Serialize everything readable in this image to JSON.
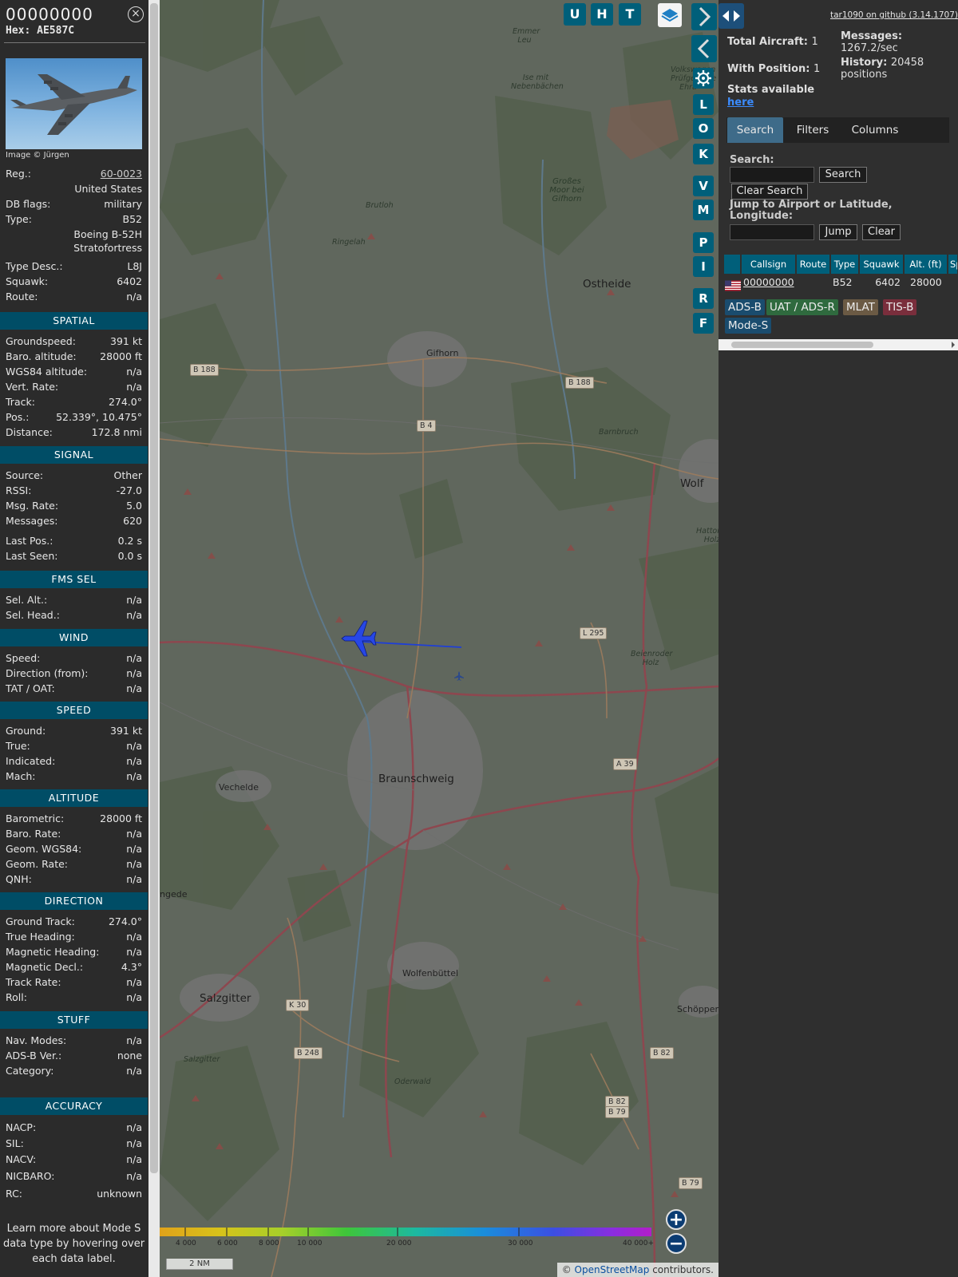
{
  "info": {
    "callsign": "00000000",
    "hex": "Hex: AE587C",
    "close_symbol": "×",
    "photo_credit": "Image © Jürgen",
    "general": [
      {
        "label": "Reg.:",
        "value": "60-0023",
        "link": true
      },
      {
        "label": "",
        "value": "United States"
      },
      {
        "label": "DB flags:",
        "value": "military"
      },
      {
        "label": "Type:",
        "value": "B52"
      },
      {
        "label": "",
        "value": "Boeing B-52H"
      },
      {
        "label": "",
        "value": "Stratofortress"
      },
      {
        "label": "Type Desc.:",
        "value": "L8J"
      },
      {
        "label": "Squawk:",
        "value": "6402"
      },
      {
        "label": "Route:",
        "value": "n/a"
      }
    ],
    "sections": {
      "spatial": "SPATIAL",
      "signal": "SIGNAL",
      "fms": "FMS SEL",
      "wind": "WIND",
      "speed": "SPEED",
      "altitude": "ALTITUDE",
      "direction": "DIRECTION",
      "stuff": "STUFF",
      "accuracy": "ACCURACY"
    },
    "spatial": [
      {
        "label": "Groundspeed:",
        "value": "391 kt"
      },
      {
        "label": "Baro. altitude:",
        "value": "28000 ft"
      },
      {
        "label": "WGS84 altitude:",
        "value": "n/a"
      },
      {
        "label": "Vert. Rate:",
        "value": "n/a"
      },
      {
        "label": "Track:",
        "value": "274.0°"
      },
      {
        "label": "Pos.:",
        "value": "52.339°, 10.475°"
      },
      {
        "label": "Distance:",
        "value": "172.8 nmi"
      }
    ],
    "signal": [
      {
        "label": "Source:",
        "value": "Other"
      },
      {
        "label": "RSSI:",
        "value": "-27.0"
      },
      {
        "label": "Msg. Rate:",
        "value": "5.0"
      },
      {
        "label": "Messages:",
        "value": "620"
      },
      {
        "label": "Last Pos.:",
        "value": "0.2 s"
      },
      {
        "label": "Last Seen:",
        "value": "0.0 s"
      }
    ],
    "fms": [
      {
        "label": "Sel. Alt.:",
        "value": "n/a"
      },
      {
        "label": "Sel. Head.:",
        "value": "n/a"
      }
    ],
    "wind": [
      {
        "label": "Speed:",
        "value": "n/a"
      },
      {
        "label": "Direction (from):",
        "value": "n/a"
      },
      {
        "label": "TAT / OAT:",
        "value": "n/a"
      }
    ],
    "speed": [
      {
        "label": "Ground:",
        "value": "391 kt"
      },
      {
        "label": "True:",
        "value": "n/a"
      },
      {
        "label": "Indicated:",
        "value": "n/a"
      },
      {
        "label": "Mach:",
        "value": "n/a"
      }
    ],
    "altitude": [
      {
        "label": "Barometric:",
        "value": "28000 ft"
      },
      {
        "label": "Baro. Rate:",
        "value": "n/a"
      },
      {
        "label": "Geom. WGS84:",
        "value": "n/a"
      },
      {
        "label": "Geom. Rate:",
        "value": "n/a"
      },
      {
        "label": "QNH:",
        "value": "n/a"
      }
    ],
    "direction": [
      {
        "label": "Ground Track:",
        "value": "274.0°"
      },
      {
        "label": "True Heading:",
        "value": "n/a"
      },
      {
        "label": "Magnetic Heading:",
        "value": "n/a"
      },
      {
        "label": "Magnetic Decl.:",
        "value": "4.3°"
      },
      {
        "label": "Track Rate:",
        "value": "n/a"
      },
      {
        "label": "Roll:",
        "value": "n/a"
      }
    ],
    "stuff": [
      {
        "label": "Nav. Modes:",
        "value": "n/a"
      },
      {
        "label": "ADS-B Ver.:",
        "value": "none"
      },
      {
        "label": "Category:",
        "value": "n/a"
      }
    ],
    "accuracy": [
      {
        "label": "NACP:",
        "value": "n/a"
      },
      {
        "label": "SIL:",
        "value": "n/a"
      },
      {
        "label": "NACV:",
        "value": "n/a"
      },
      {
        "label": "NICBARO:",
        "value": "n/a"
      },
      {
        "label": "RC:",
        "value": "unknown"
      }
    ],
    "learn_more": "Learn more about Mode S data type by hovering over each data label."
  },
  "map": {
    "buttons_top": [
      "U",
      "H",
      "T"
    ],
    "buttons_side": [
      "L",
      "O",
      "K",
      "V",
      "M",
      "P",
      "I",
      "R",
      "F"
    ],
    "places": [
      {
        "text": "Emmer Leu",
        "cls": "small"
      },
      {
        "text": "Ise mit Nebenbächen",
        "cls": "small"
      },
      {
        "text": "Volkswagen Prüfgelände Ehra",
        "cls": "small"
      },
      {
        "text": "Großes Moor bei Gifhorn",
        "cls": "med"
      },
      {
        "text": "Brutloh",
        "cls": "small"
      },
      {
        "text": "Ringelah",
        "cls": "small"
      },
      {
        "text": "Ostheide",
        "cls": "big"
      },
      {
        "text": "Gifhorn",
        "cls": "city"
      },
      {
        "text": "Barnbruch",
        "cls": "small"
      },
      {
        "text": "Wolf",
        "cls": "big"
      },
      {
        "text": "Hattorfer Holz",
        "cls": "small"
      },
      {
        "text": "Beienroder Holz",
        "cls": "small"
      },
      {
        "text": "Braunschweig",
        "cls": "big"
      },
      {
        "text": "Vechelde",
        "cls": "city"
      },
      {
        "text": "ngede",
        "cls": "city"
      },
      {
        "text": "Wolfenbüttel",
        "cls": "city"
      },
      {
        "text": "Salzgitter",
        "cls": "big"
      },
      {
        "text": "Schöppen",
        "cls": "city"
      },
      {
        "text": "Salzgitter",
        "cls": "small"
      },
      {
        "text": "Oderwald",
        "cls": "small"
      }
    ],
    "road_labels": [
      "B 188",
      "B 188",
      "B 4",
      "L 295",
      "A 39",
      "K 30",
      "B 248",
      "B 82",
      "B 82",
      "B 79",
      "B 79"
    ],
    "alt_scale_labels": [
      "4 000",
      "6 000",
      "8 000",
      "10 000",
      "20 000",
      "30 000",
      "40 000+"
    ],
    "scale_text": "2 NM",
    "zoom_in": "+",
    "zoom_out": "−",
    "attribution_prefix": "© ",
    "attribution_link": "OpenStreetMap",
    "attribution_suffix": " contributors."
  },
  "sidebar": {
    "version": "tar1090 on github (3.14.1707)",
    "total_aircraft_label": "Total Aircraft:",
    "total_aircraft": "1",
    "with_position_label": "With Position:",
    "with_position": "1",
    "messages_label": "Messages:",
    "messages": "1267.2/sec",
    "history_label": "History:",
    "history": "20458",
    "history_unit": "positions",
    "stats_label": "Stats available",
    "stats_link": "here",
    "tabs": [
      "Search",
      "Filters",
      "Columns"
    ],
    "search_label": "Search:",
    "search_button": "Search",
    "clear_search_button": "Clear Search",
    "jump_label": "Jump to Airport or Latitude, Longitude:",
    "jump_button": "Jump",
    "clear_button": "Clear",
    "table_headers": [
      "Callsign",
      "Route",
      "Type",
      "Squawk",
      "Alt. (ft)",
      "Sp"
    ],
    "table_row": {
      "callsign": "00000000",
      "route": "",
      "type": "B52",
      "squawk": "6402",
      "alt": "28000"
    },
    "badges": [
      {
        "text": "ADS-B",
        "color": "#1a4c6e"
      },
      {
        "text": "UAT / ADS-R",
        "color": "#2f6a3e"
      },
      {
        "text": "MLAT",
        "color": "#6b5a44"
      },
      {
        "text": "TIS-B",
        "color": "#7a2e3c"
      },
      {
        "text": "Mode-S",
        "color": "#1a4c6e"
      }
    ]
  },
  "colors": {
    "section_bg": "#004d66",
    "button_teal": "#005f7a",
    "aircraft_blue": "#1f3fd6",
    "active_tab": "#3e6b89"
  }
}
